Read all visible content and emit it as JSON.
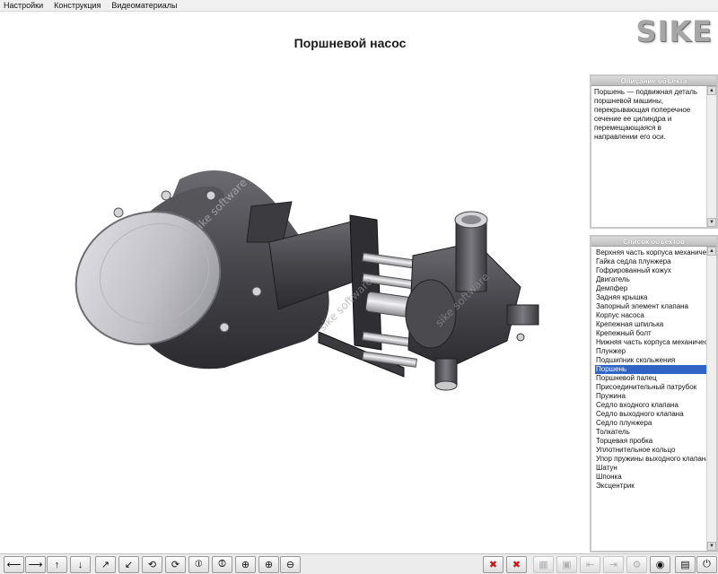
{
  "menu": [
    "Настройки",
    "Конструкция",
    "Видеоматериалы"
  ],
  "logo_text": "SIKE",
  "title": "Поршневой насос",
  "description_panel": {
    "title": "Описание объекта",
    "text": "Поршень — подвижная деталь поршневой машины, перекрывающая поперечное сечение ее цилиндра и перемещающаяся в направлении его оси."
  },
  "objects_panel": {
    "title": "Список объектов",
    "selected": "Поршень",
    "items": [
      "Верхняя часть корпуса механического",
      "Гайка седла плунжера",
      "Гофрированный кожух",
      "Двигатель",
      "Демпфер",
      "Задняя крышка",
      "Запорный элемент клапана",
      "Корпус насоса",
      "Крепежная шпилька",
      "Крепежный болт",
      "Нижняя часть корпуса механическо",
      "Плунжер",
      "Подшипник скольжения",
      "Поршень",
      "Поршневой палец",
      "Присоединительный патрубок",
      "Пружина",
      "Седло входного клапана",
      "Седло выходного клапана",
      "Седло плунжера",
      "Толкатель",
      "Торцевая пробка",
      "Уплотнительное кольцо",
      "Упор пружины выходного клапана",
      "Шатун",
      "Шпонка",
      "Эксцентрик"
    ]
  },
  "watermark": "sike software",
  "toolbar": {
    "left_buttons": [
      {
        "name": "move-left",
        "glyph": "⟵",
        "icon": "arrow-left-icon"
      },
      {
        "name": "move-right",
        "glyph": "⟶",
        "icon": "arrow-right-icon"
      },
      {
        "name": "move-up",
        "glyph": "↑",
        "icon": "arrow-up-icon"
      },
      {
        "name": "move-down",
        "glyph": "↓",
        "icon": "arrow-down-icon"
      },
      {
        "name": "move-diagonal-up",
        "glyph": "↗",
        "icon": "arrow-diagonal-up-icon"
      },
      {
        "name": "move-diagonal-down",
        "glyph": "↙",
        "icon": "arrow-diagonal-down-icon"
      },
      {
        "name": "rotate-horizontal",
        "glyph": "⟲",
        "icon": "rotate-horizontal-icon"
      },
      {
        "name": "rotate-horizontal-back",
        "glyph": "⟳",
        "icon": "rotate-horizontal-back-icon"
      },
      {
        "name": "rotate-vertical",
        "glyph": "⦶",
        "icon": "rotate-vertical-icon"
      },
      {
        "name": "rotate-vertical-back",
        "glyph": "⦷",
        "icon": "rotate-vertical-back-icon"
      },
      {
        "name": "rotate-axis",
        "glyph": "⊕",
        "icon": "rotate-axis-icon"
      },
      {
        "name": "zoom-in",
        "glyph": "⊕",
        "icon": "zoom-in-icon"
      },
      {
        "name": "zoom-out",
        "glyph": "⊖",
        "icon": "zoom-out-icon"
      }
    ],
    "right_buttons": [
      {
        "name": "hide-selected",
        "glyph": "✖",
        "icon": "hide-selected-icon",
        "state": "red"
      },
      {
        "name": "hide-others",
        "glyph": "✖",
        "icon": "hide-others-icon",
        "state": "red"
      },
      {
        "name": "show-all",
        "glyph": "▦",
        "icon": "show-all-icon",
        "state": "disabled"
      },
      {
        "name": "transparency",
        "glyph": "▣",
        "icon": "transparency-icon",
        "state": "disabled"
      },
      {
        "name": "explode",
        "glyph": "⇤",
        "icon": "explode-icon",
        "state": "disabled"
      },
      {
        "name": "collapse",
        "glyph": "⇥",
        "icon": "collapse-icon",
        "state": "disabled"
      },
      {
        "name": "settings-tool",
        "glyph": "⚙",
        "icon": "gear-icon",
        "state": "disabled"
      },
      {
        "name": "view-toggle",
        "glyph": "◉",
        "icon": "eye-icon",
        "state": "normal"
      },
      {
        "name": "document",
        "glyph": "▤",
        "icon": "document-icon",
        "state": "normal"
      },
      {
        "name": "exit",
        "glyph": "⏻",
        "icon": "power-icon",
        "state": "normal"
      }
    ]
  }
}
